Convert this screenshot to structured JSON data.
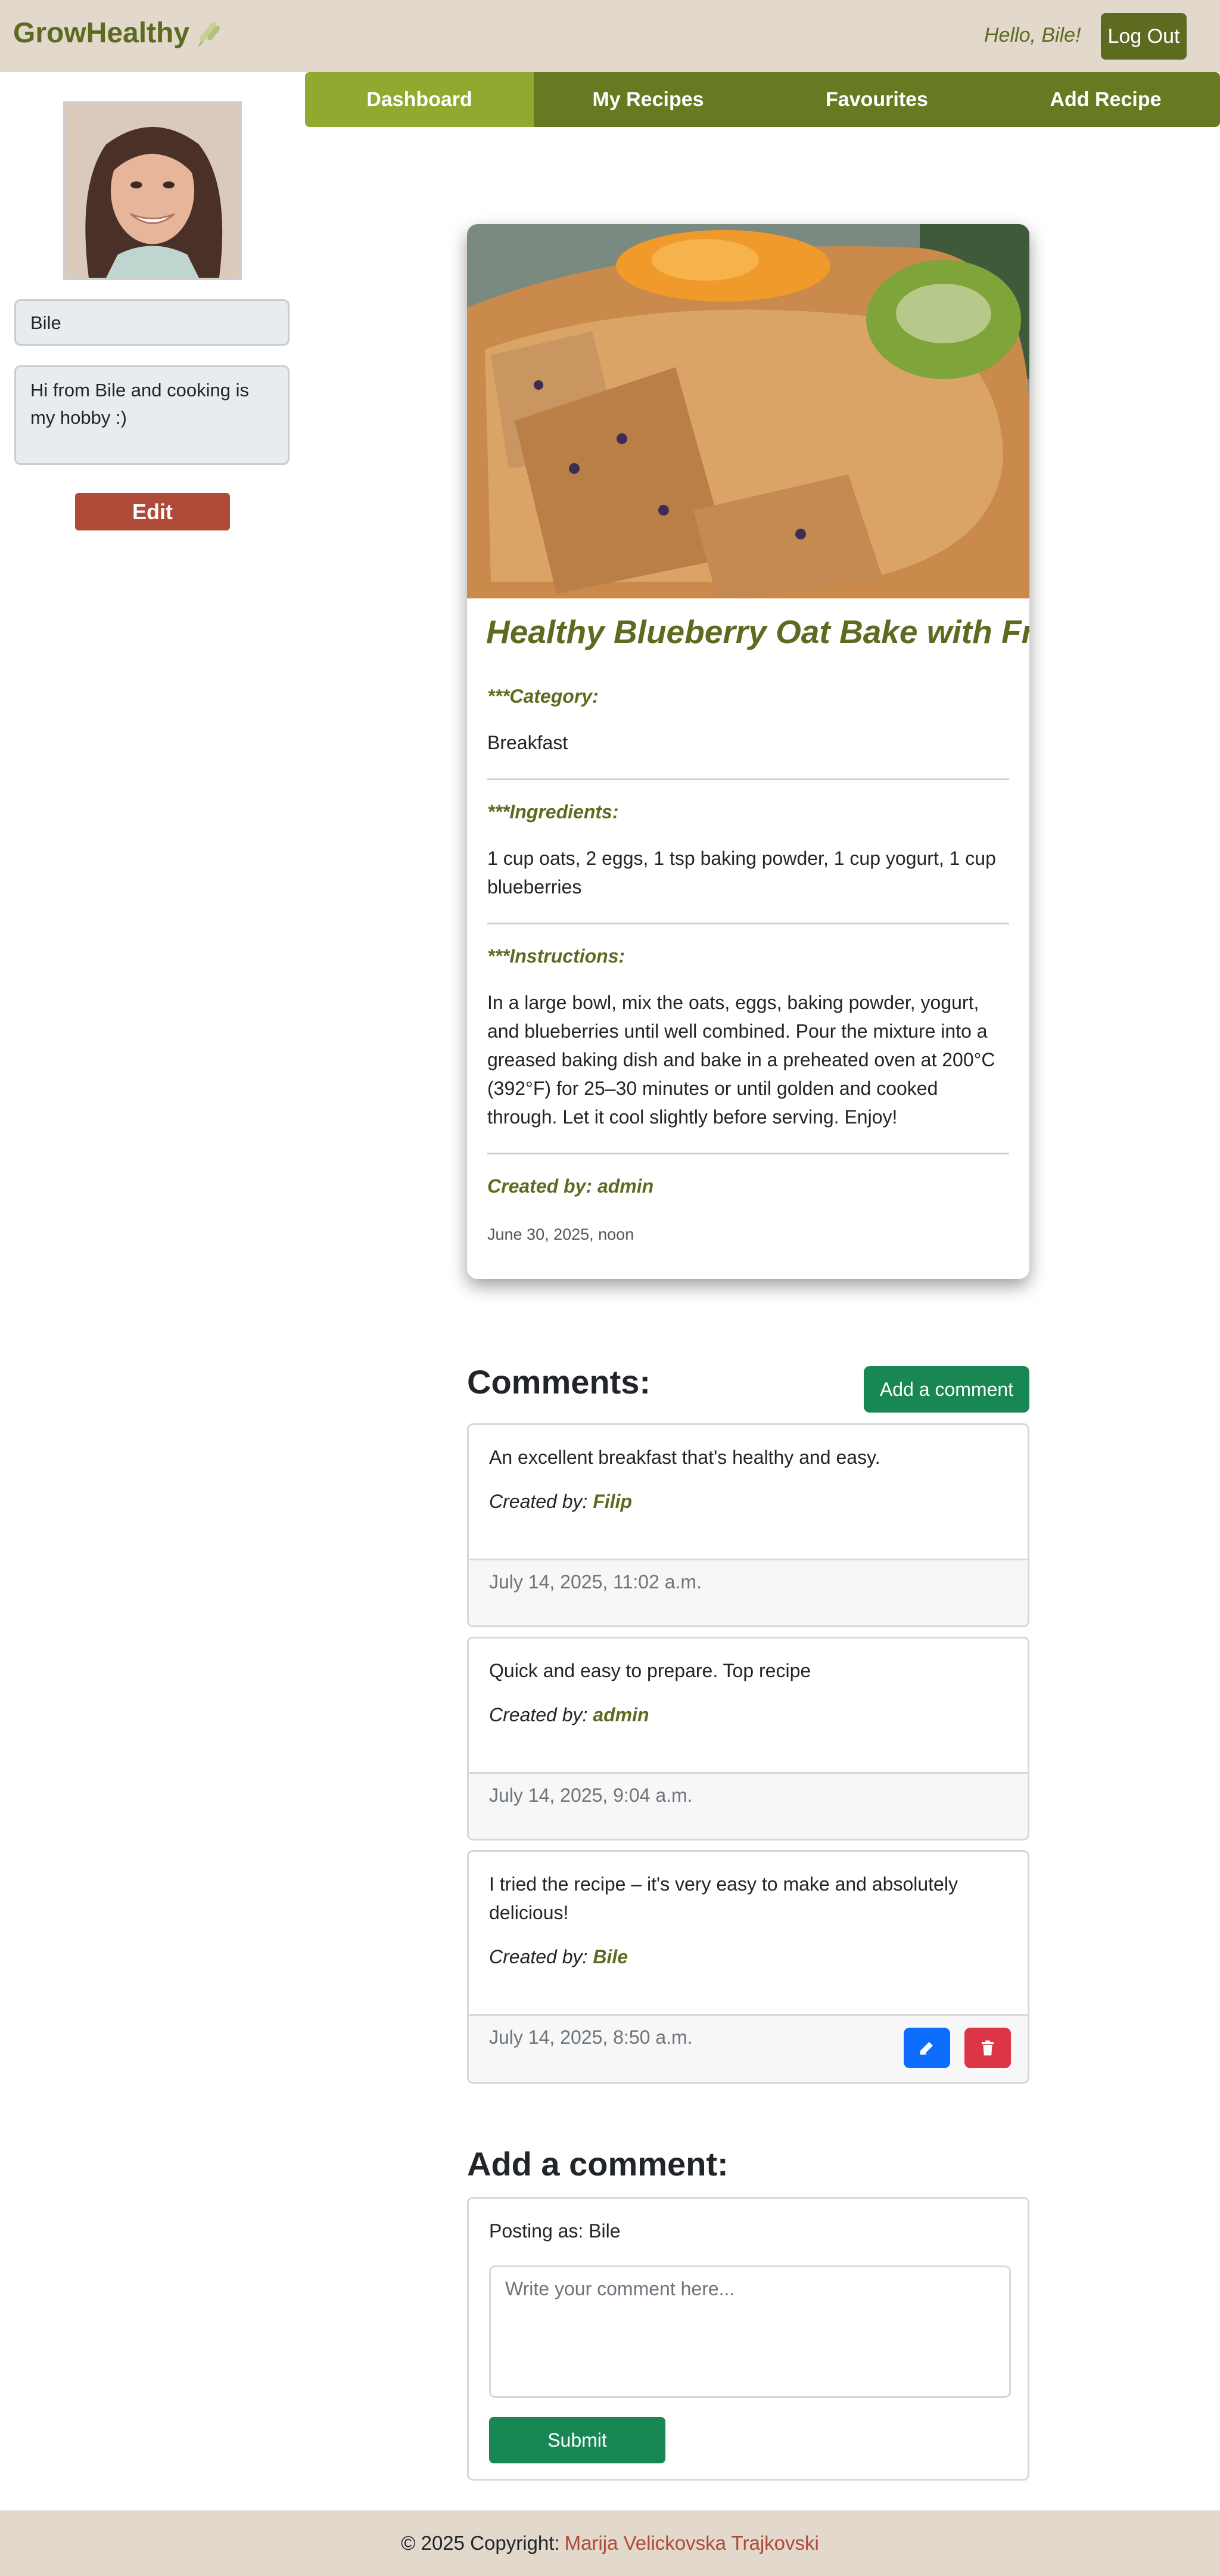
{
  "header": {
    "brand": "GrowHealthy",
    "greeting": "Hello, Bile!",
    "logout_label": "Log Out"
  },
  "nav": {
    "items": [
      {
        "label": "Dashboard",
        "active": true
      },
      {
        "label": "My Recipes",
        "active": false
      },
      {
        "label": "Favourites",
        "active": false
      },
      {
        "label": "Add Recipe",
        "active": false
      }
    ]
  },
  "profile": {
    "name": "Bile",
    "bio": "Hi from Bile  and cooking is my hobby :)",
    "edit_label": "Edit"
  },
  "recipe": {
    "title": "Healthy Blueberry Oat Bake with Fruit",
    "category_label": "***Category:",
    "category": "Breakfast",
    "ingredients_label": "***Ingredients:",
    "ingredients": "1 cup oats, 2 eggs, 1 tsp baking powder, 1 cup yogurt, 1 cup blueberries",
    "instructions_label": "***Instructions:",
    "instructions": "In a large bowl, mix the oats, eggs, baking powder, yogurt, and blueberries until well combined. Pour the mixture into a greased baking dish and bake in a preheated oven at 200°C (392°F) for 25–30 minutes or until golden and cooked through. Let it cool slightly before serving. Enjoy!",
    "created_by": "Created by: admin",
    "created_date": "June 30, 2025, noon"
  },
  "comments": {
    "title": "Comments:",
    "add_button_label": "Add a comment",
    "created_by_prefix": "Created by:",
    "items": [
      {
        "text": "An excellent breakfast that's healthy and easy.",
        "author": "Filip",
        "date": "July 14, 2025, 11:02 a.m."
      },
      {
        "text": "Quick and easy to prepare. Top recipe",
        "author": "admin",
        "date": "July 14, 2025, 9:04 a.m."
      },
      {
        "text": "I tried the recipe – it's very easy to make and absolutely delicious!",
        "author": "Bile",
        "date": "July 14, 2025, 8:50 a.m."
      }
    ]
  },
  "add_comment": {
    "title": "Add a comment:",
    "posting_as": "Posting as: Bile",
    "placeholder": "Write your comment here...",
    "submit_label": "Submit"
  },
  "footer": {
    "copyright": "© 2025 Copyright:",
    "author": "Marija Velickovska Trajkovski"
  },
  "colors": {
    "olive": "#5c6b1f",
    "nav_active": "#8faa2e",
    "beige": "#e2d8cc",
    "green_button": "#198754",
    "edit_red": "#b04a38"
  }
}
